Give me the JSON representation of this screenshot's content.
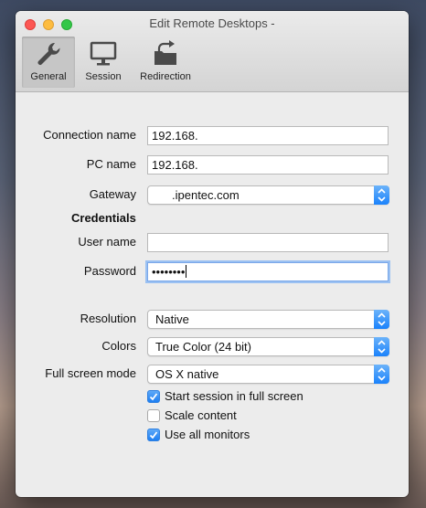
{
  "window": {
    "title": "Edit Remote Desktops -"
  },
  "toolbar": {
    "general_label": "General",
    "session_label": "Session",
    "redirection_label": "Redirection"
  },
  "form": {
    "connection_name": {
      "label": "Connection name",
      "value": "192.168."
    },
    "pc_name": {
      "label": "PC name",
      "value": "192.168."
    },
    "gateway": {
      "label": "Gateway",
      "value": ".ipentec.com"
    },
    "credentials_heading": "Credentials",
    "user_name": {
      "label": "User name",
      "value": ""
    },
    "password": {
      "label": "Password",
      "value": "••••••••"
    },
    "resolution": {
      "label": "Resolution",
      "value": "Native"
    },
    "colors": {
      "label": "Colors",
      "value": "True Color (24 bit)"
    },
    "full_screen_mode": {
      "label": "Full screen mode",
      "value": "OS X native"
    },
    "options": [
      {
        "label": "Start session in full screen",
        "checked": true
      },
      {
        "label": "Scale content",
        "checked": false
      },
      {
        "label": "Use all monitors",
        "checked": true
      }
    ]
  },
  "colors": {
    "accent": "#1a82fb",
    "close": "#fc5753",
    "minimize": "#fdbc40",
    "maximize": "#33c748"
  }
}
